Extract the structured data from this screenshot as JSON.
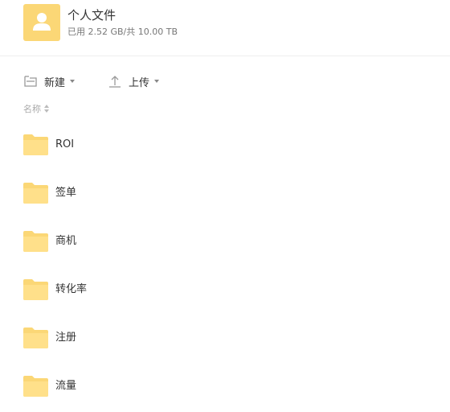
{
  "space": {
    "title": "个人文件",
    "usage": "已用 2.52 GB/共 10.00 TB",
    "avatar_icon": "user-icon",
    "accent_color": "#fbd776"
  },
  "toolbar": {
    "new_label": "新建",
    "new_icon": "new-folder-icon",
    "upload_label": "上传",
    "upload_icon": "upload-icon"
  },
  "list": {
    "column_name": "名称",
    "sort_icon": "sort-icon",
    "items": [
      {
        "name": "ROI",
        "icon": "folder-icon"
      },
      {
        "name": "签单",
        "icon": "folder-icon"
      },
      {
        "name": "商机",
        "icon": "folder-icon"
      },
      {
        "name": "转化率",
        "icon": "folder-icon"
      },
      {
        "name": "注册",
        "icon": "folder-icon"
      },
      {
        "name": "流量",
        "icon": "folder-icon"
      }
    ]
  }
}
